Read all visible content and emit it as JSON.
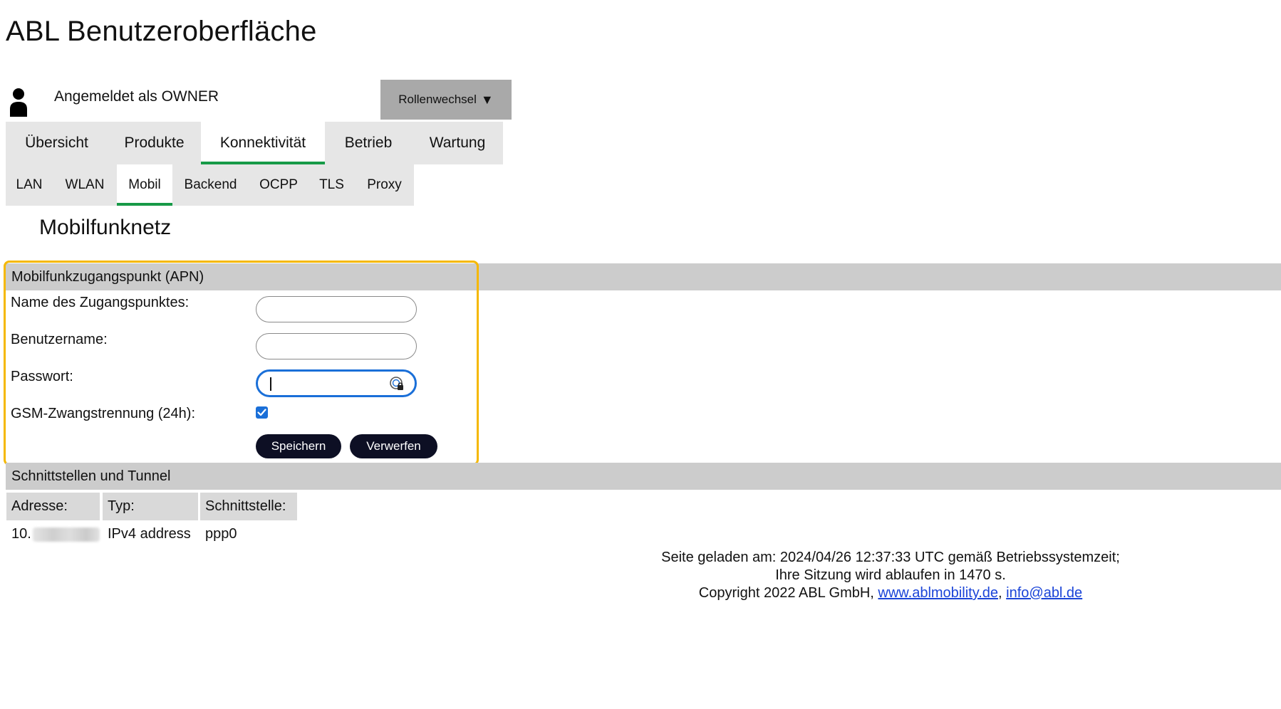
{
  "app": {
    "title": "ABL Benutzeroberfläche"
  },
  "user": {
    "icon": "user-icon",
    "logged_in_label": "Angemeldet als OWNER",
    "role_switch_label": "Rollenwechsel",
    "role_switch_caret": "▼"
  },
  "main_tabs": [
    {
      "label": "Übersicht",
      "active": false
    },
    {
      "label": "Produkte",
      "active": false
    },
    {
      "label": "Konnektivität",
      "active": true
    },
    {
      "label": "Betrieb",
      "active": false
    },
    {
      "label": "Wartung",
      "active": false
    }
  ],
  "sub_tabs": [
    {
      "label": "LAN",
      "active": false
    },
    {
      "label": "WLAN",
      "active": false
    },
    {
      "label": "Mobil",
      "active": true
    },
    {
      "label": "Backend",
      "active": false
    },
    {
      "label": "OCPP",
      "active": false
    },
    {
      "label": "TLS",
      "active": false
    },
    {
      "label": "Proxy",
      "active": false
    }
  ],
  "page": {
    "heading": "Mobilfunknetz"
  },
  "apn": {
    "section_title": "Mobilfunkzugangspunkt (APN)",
    "fields": {
      "apn_name": {
        "label": "Name des Zugangspunktes:",
        "value": ""
      },
      "username": {
        "label": "Benutzername:",
        "value": ""
      },
      "password": {
        "label": "Passwort:",
        "value": ""
      },
      "gsm_disconnect": {
        "label": "GSM-Zwangstrennung (24h):",
        "checked": true
      }
    },
    "save_label": "Speichern",
    "discard_label": "Verwerfen"
  },
  "interfaces": {
    "section_title": "Schnittstellen und Tunnel",
    "columns": [
      "Adresse:",
      "Typ:",
      "Schnittstelle:"
    ],
    "rows": [
      {
        "address_prefix": "10.",
        "type": "IPv4 address",
        "interface": "ppp0"
      }
    ]
  },
  "footer": {
    "line1": "Seite geladen am: 2024/04/26 12:37:33 UTC gemäß Betriebssystemzeit;",
    "line2": "Ihre Sitzung wird ablaufen in 1470 s.",
    "copyright": "Copyright 2022 ABL GmbH, ",
    "separator": ", ",
    "link1": "www.ablmobility.de",
    "link2": "info@abl.de"
  },
  "colors": {
    "accent_green": "#179a47",
    "highlight": "#f5b800",
    "focus_blue": "#1a6fd8",
    "button_dark": "#0d0f24",
    "link_blue": "#1a44d8"
  }
}
